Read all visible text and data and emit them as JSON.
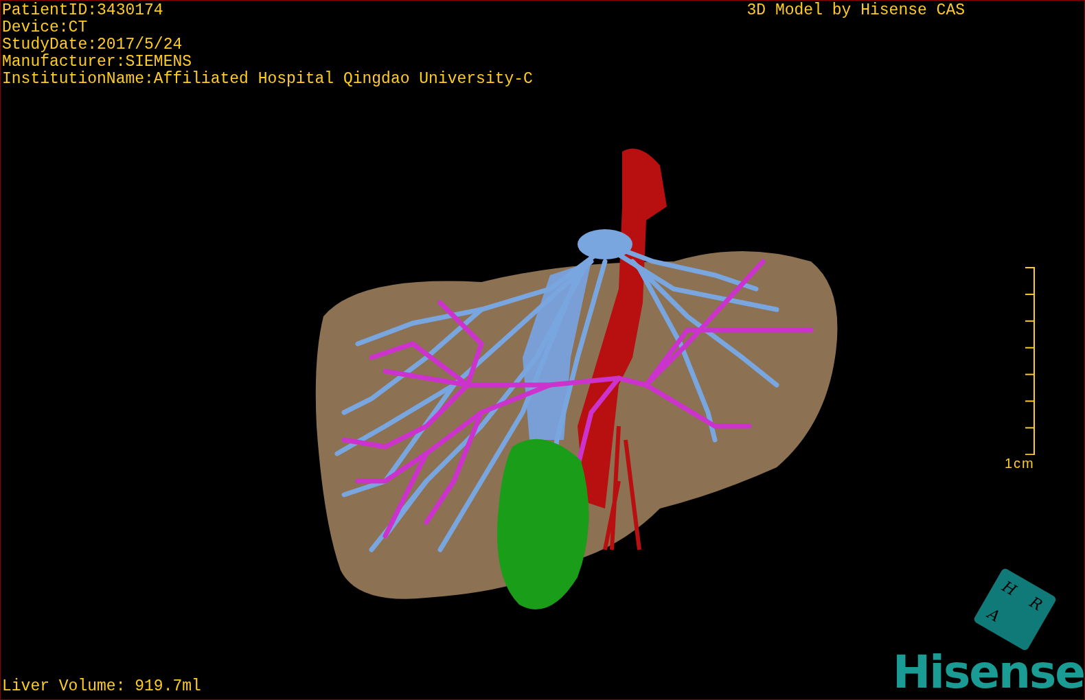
{
  "info_lines": [
    "PatientID:3430174",
    "Device:CT",
    "StudyDate:2017/5/24",
    "Manufacturer:SIEMENS",
    "InstitutionName:Affiliated Hospital Qingdao University-C"
  ],
  "credit": "3D Model by Hisense CAS",
  "scale_bar": {
    "label": "1cm"
  },
  "orientation_cube": {
    "faces": [
      "H",
      "R",
      "A"
    ]
  },
  "logo": "Hisense",
  "liver_volume": "Liver Volume: 919.7ml"
}
